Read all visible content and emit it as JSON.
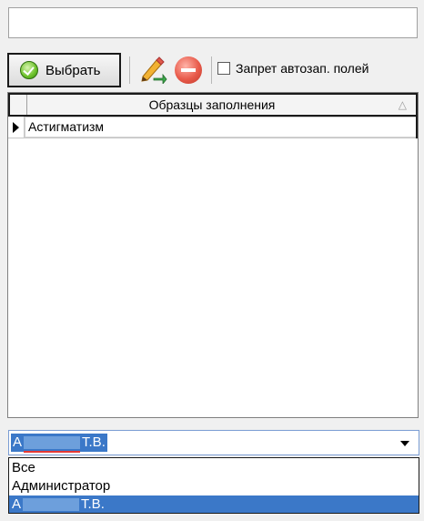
{
  "toolbar": {
    "select_label": "Выбрать",
    "checkbox_label": "Запрет автозап. полей",
    "checkbox_checked": false
  },
  "grid": {
    "column_header": "Образцы заполнения",
    "sort_glyph": "△",
    "rows": [
      "Астигматизм"
    ]
  },
  "user_combo": {
    "selected_prefix": "А",
    "selected_suffix": "Т.В."
  },
  "user_dropdown": {
    "options": [
      "Все",
      "Администратор"
    ],
    "selected_prefix": "А",
    "selected_suffix": "Т.В."
  },
  "colors": {
    "selection": "#3b78c8",
    "panel": "#f0f0f0"
  },
  "icons": [
    "check-circle-icon",
    "edit-pencil-icon",
    "delete-icon",
    "sort-triangle-icon",
    "row-pointer-icon",
    "dropdown-arrow-icon"
  ]
}
